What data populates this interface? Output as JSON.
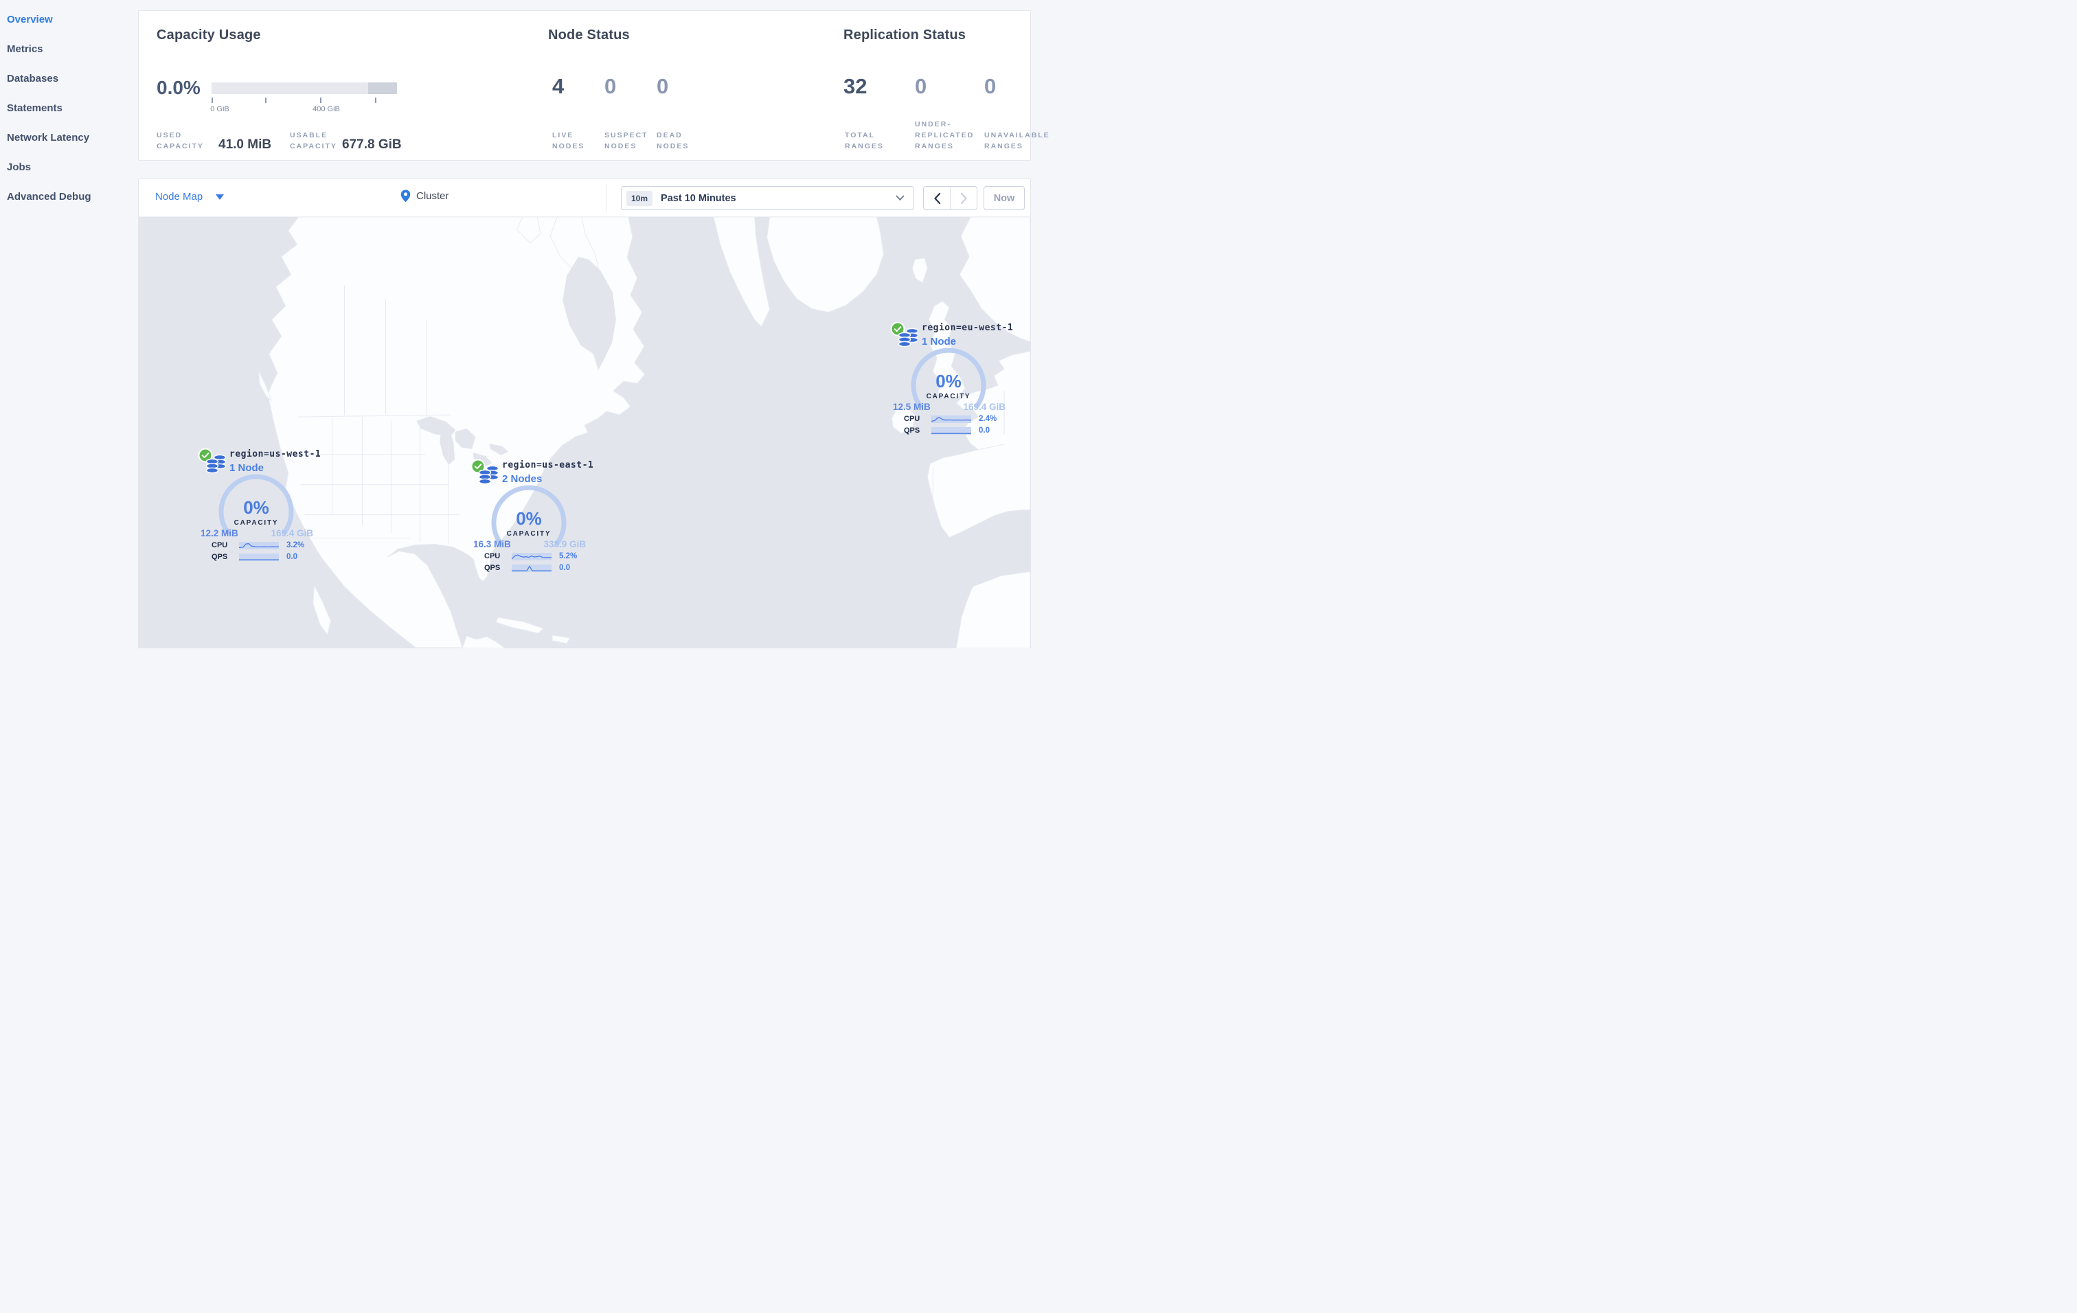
{
  "colors": {
    "accent_blue": "#2f7cdf",
    "link_blue": "#4a7de2",
    "status_green": "#5bb84c",
    "ocean": "#e2e5ec",
    "gauge_arc": "#bccff1"
  },
  "sidebar": {
    "items": [
      {
        "label": "Overview",
        "active": true
      },
      {
        "label": "Metrics",
        "active": false
      },
      {
        "label": "Databases",
        "active": false
      },
      {
        "label": "Statements",
        "active": false
      },
      {
        "label": "Network Latency",
        "active": false
      },
      {
        "label": "Jobs",
        "active": false
      },
      {
        "label": "Advanced Debug",
        "active": false
      }
    ]
  },
  "summary": {
    "capacity": {
      "title": "Capacity Usage",
      "percent": "0.0%",
      "tick_labels": [
        "0 GiB",
        "400 GiB"
      ],
      "used_label": "USED\nCAPACITY",
      "used_value": "41.0 MiB",
      "usable_label": "USABLE\nCAPACITY",
      "usable_value": "677.8 GiB"
    },
    "node_status": {
      "title": "Node Status",
      "stats": [
        {
          "value": "4",
          "label": "LIVE\nNODES"
        },
        {
          "value": "0",
          "label": "SUSPECT\nNODES"
        },
        {
          "value": "0",
          "label": "DEAD\nNODES"
        }
      ]
    },
    "replication": {
      "title": "Replication Status",
      "stats": [
        {
          "value": "32",
          "label": "TOTAL\nRANGES"
        },
        {
          "value": "0",
          "label": "UNDER-\nREPLICATED\nRANGES"
        },
        {
          "value": "0",
          "label": "UNAVAILABLE\nRANGES"
        }
      ]
    }
  },
  "toolbar": {
    "view_selector": "Node Map",
    "breadcrumb": "Cluster",
    "time_badge": "10m",
    "time_range": "Past 10 Minutes",
    "now_button": "Now"
  },
  "map": {
    "regions": [
      {
        "name": "region=us-west-1",
        "nodes": "1 Node",
        "capacity_percent": "0%",
        "capacity_label": "CAPACITY",
        "used": "12.2 MiB",
        "usable": "169.4 GiB",
        "cpu_label": "CPU",
        "cpu": "3.2%",
        "qps_label": "QPS",
        "qps": "0.0"
      },
      {
        "name": "region=us-east-1",
        "nodes": "2 Nodes",
        "capacity_percent": "0%",
        "capacity_label": "CAPACITY",
        "used": "16.3 MiB",
        "usable": "338.9 GiB",
        "cpu_label": "CPU",
        "cpu": "5.2%",
        "qps_label": "QPS",
        "qps": "0.0"
      },
      {
        "name": "region=eu-west-1",
        "nodes": "1 Node",
        "capacity_percent": "0%",
        "capacity_label": "CAPACITY",
        "used": "12.5 MiB",
        "usable": "169.4 GiB",
        "cpu_label": "CPU",
        "cpu": "2.4%",
        "qps_label": "QPS",
        "qps": "0.0"
      }
    ]
  }
}
